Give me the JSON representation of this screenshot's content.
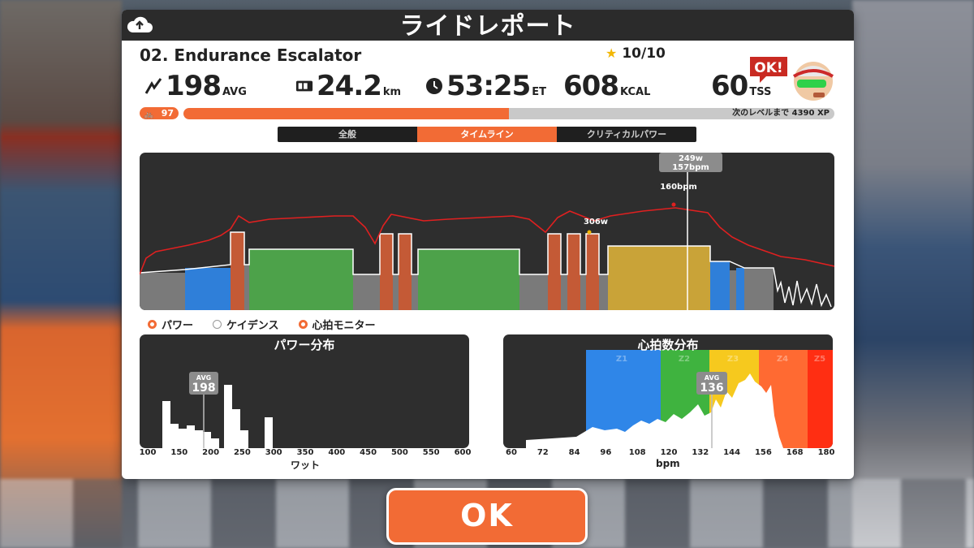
{
  "window": {
    "title": "ライドレポート"
  },
  "workout": {
    "name": "02. Endurance Escalator",
    "rating": "10/10"
  },
  "stats": {
    "power": {
      "value": "198",
      "unit": "AVG"
    },
    "distance": {
      "value": "24.2",
      "unit": "km"
    },
    "time": {
      "value": "53:25",
      "unit": "ET"
    },
    "calories": {
      "value": "608",
      "unit": "KCAL"
    },
    "tss": {
      "value": "60",
      "unit": "TSS"
    }
  },
  "avatar": {
    "badge": "OK!"
  },
  "level": {
    "number": "97",
    "xp_text": "次のレベルまで",
    "xp_value": "4390 XP",
    "progress": 0.5
  },
  "tabs": [
    "全般",
    "タイムライン",
    "クリティカルパワー"
  ],
  "active_tab": 1,
  "timeline": {
    "tooltip_power": "249w",
    "tooltip_hr": "157bpm",
    "peak_hr_label": "160bpm",
    "peak_power_label": "306w"
  },
  "legend": [
    {
      "label": "パワー",
      "on": true
    },
    {
      "label": "ケイデンス",
      "on": false
    },
    {
      "label": "心拍モニター",
      "on": true
    }
  ],
  "power_dist": {
    "title": "パワー分布",
    "avg_label": "AVG",
    "avg_value": "198",
    "x_ticks": [
      "100",
      "150",
      "200",
      "250",
      "300",
      "350",
      "400",
      "450",
      "500",
      "550",
      "600"
    ],
    "x_name": "ワット"
  },
  "hr_dist": {
    "title": "心拍数分布",
    "avg_label": "AVG",
    "avg_value": "136",
    "zones": [
      "Z1",
      "Z2",
      "Z3",
      "Z4",
      "Z5"
    ],
    "x_ticks": [
      "60",
      "72",
      "84",
      "96",
      "108",
      "120",
      "132",
      "144",
      "156",
      "168",
      "180"
    ],
    "x_name": "bpm"
  },
  "ok_label": "OK",
  "colors": {
    "accent": "#f26b35",
    "zone_gray": "#7a7a7a",
    "zone_blue": "#2f7fd9",
    "zone_green": "#4da24a",
    "zone_yellow": "#c9a338",
    "zone_orange": "#c45a36",
    "hr_line": "#e02020"
  }
}
